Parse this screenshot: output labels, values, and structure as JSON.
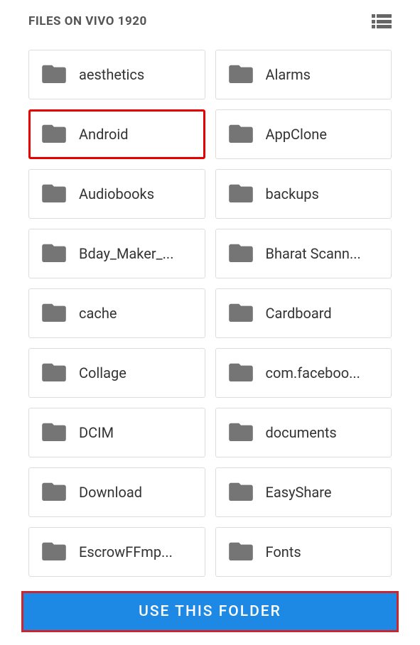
{
  "header": {
    "title": "FILES ON VIVO 1920"
  },
  "folders": [
    {
      "label": "aesthetics",
      "highlighted": false
    },
    {
      "label": "Alarms",
      "highlighted": false
    },
    {
      "label": "Android",
      "highlighted": true
    },
    {
      "label": "AppClone",
      "highlighted": false
    },
    {
      "label": "Audiobooks",
      "highlighted": false
    },
    {
      "label": "backups",
      "highlighted": false
    },
    {
      "label": "Bday_Maker_...",
      "highlighted": false
    },
    {
      "label": "Bharat Scann...",
      "highlighted": false
    },
    {
      "label": "cache",
      "highlighted": false
    },
    {
      "label": "Cardboard",
      "highlighted": false
    },
    {
      "label": "Collage",
      "highlighted": false
    },
    {
      "label": "com.faceboo...",
      "highlighted": false
    },
    {
      "label": "DCIM",
      "highlighted": false
    },
    {
      "label": "documents",
      "highlighted": false
    },
    {
      "label": "Download",
      "highlighted": false
    },
    {
      "label": "EasyShare",
      "highlighted": false
    },
    {
      "label": "EscrowFFmp...",
      "highlighted": false
    },
    {
      "label": "Fonts",
      "highlighted": false
    }
  ],
  "footer": {
    "use_label": "USE THIS FOLDER"
  }
}
